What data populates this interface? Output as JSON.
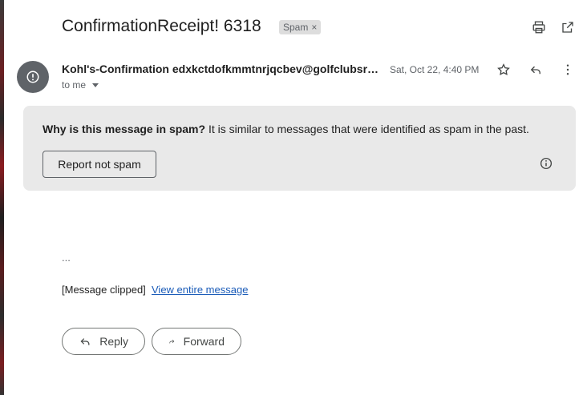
{
  "email": {
    "subject": "ConfirmationReceipt! 6318",
    "label_chip": "Spam",
    "label_chip_close": "×",
    "sender_name": "Kohl's-Confirmation",
    "sender_email": "edxkctdofkmmtnrjqcbev@golfclubsr…",
    "date": "Sat, Oct 22, 4:40 PM",
    "recipient": "to me"
  },
  "spam_warning": {
    "question": "Why is this message in spam?",
    "explanation": " It is similar to messages that were identified as spam in the past.",
    "report_button": "Report not spam"
  },
  "body": {
    "ellipsis": "...",
    "clipped_notice": "[Message clipped]",
    "view_entire_link": "View entire message"
  },
  "actions": {
    "reply": "Reply",
    "forward": "Forward"
  },
  "icons": {
    "print": "print-icon",
    "open_new_window": "open-in-new-icon",
    "star": "star-icon",
    "reply": "reply-icon",
    "more": "more-vert-icon",
    "avatar": "alert-icon",
    "info": "info-icon",
    "forward": "forward-icon"
  }
}
